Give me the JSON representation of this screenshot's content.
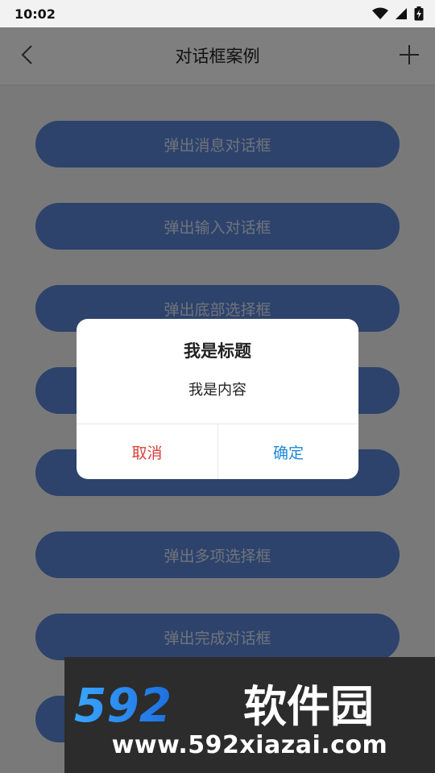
{
  "status_bar": {
    "time": "10:02",
    "icons": [
      "wifi-icon",
      "signal-icon",
      "battery-charging-icon"
    ]
  },
  "title_bar": {
    "title": "对话框案例",
    "back_icon": "chevron-left-icon",
    "add_icon": "plus-icon"
  },
  "buttons": [
    {
      "label": "弹出消息对话框"
    },
    {
      "label": "弹出输入对话框"
    },
    {
      "label": "弹出底部选择框"
    },
    {
      "label": ""
    },
    {
      "label": ""
    },
    {
      "label": "弹出多项选择框"
    },
    {
      "label": "弹出完成对话框"
    },
    {
      "label": ""
    }
  ],
  "dialog": {
    "title": "我是标题",
    "message": "我是内容",
    "cancel_label": "取消",
    "confirm_label": "确定"
  },
  "watermark": {
    "logo_text": "592软件园",
    "url": "www.592xiazai.com"
  },
  "colors": {
    "button_fill": "#5b86d8",
    "cancel": "#d9413b",
    "confirm": "#1e88d6",
    "overlay": "rgba(0,0,0,0.5)"
  }
}
